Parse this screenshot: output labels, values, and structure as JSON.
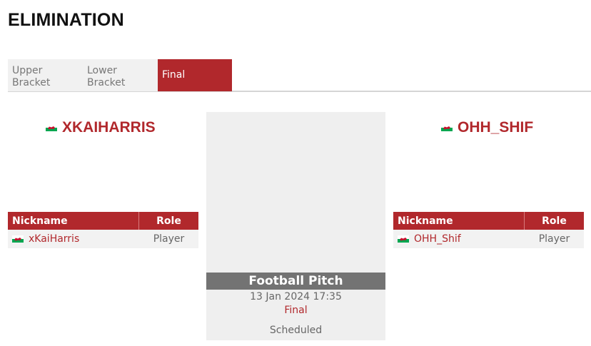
{
  "page": {
    "title": "ELIMINATION"
  },
  "tabs": [
    {
      "label_line1": "Upper",
      "label_line2": "Bracket",
      "active": false
    },
    {
      "label_line1": "Lower",
      "label_line2": "Bracket",
      "active": false
    },
    {
      "label": "Final",
      "active": true
    }
  ],
  "teams": {
    "left": {
      "name": "XKAIHARRIS",
      "flag_icon": "wales-flag-icon"
    },
    "right": {
      "name": "OHH_SHIF",
      "flag_icon": "wales-flag-icon"
    }
  },
  "roster_columns": {
    "nickname": "Nickname",
    "role": "Role"
  },
  "roster_left": [
    {
      "nickname": "xKaiHarris",
      "role": "Player"
    }
  ],
  "roster_right": [
    {
      "nickname": "OHH_Shif",
      "role": "Player"
    }
  ],
  "match": {
    "venue": "Football Pitch",
    "datetime": "13 Jan 2024 17:35",
    "stage": "Final",
    "status": "Scheduled"
  },
  "colors": {
    "accent": "#b1282c",
    "venue_bar": "#737373",
    "panel": "#efefef",
    "row": "#f2f2f2"
  }
}
